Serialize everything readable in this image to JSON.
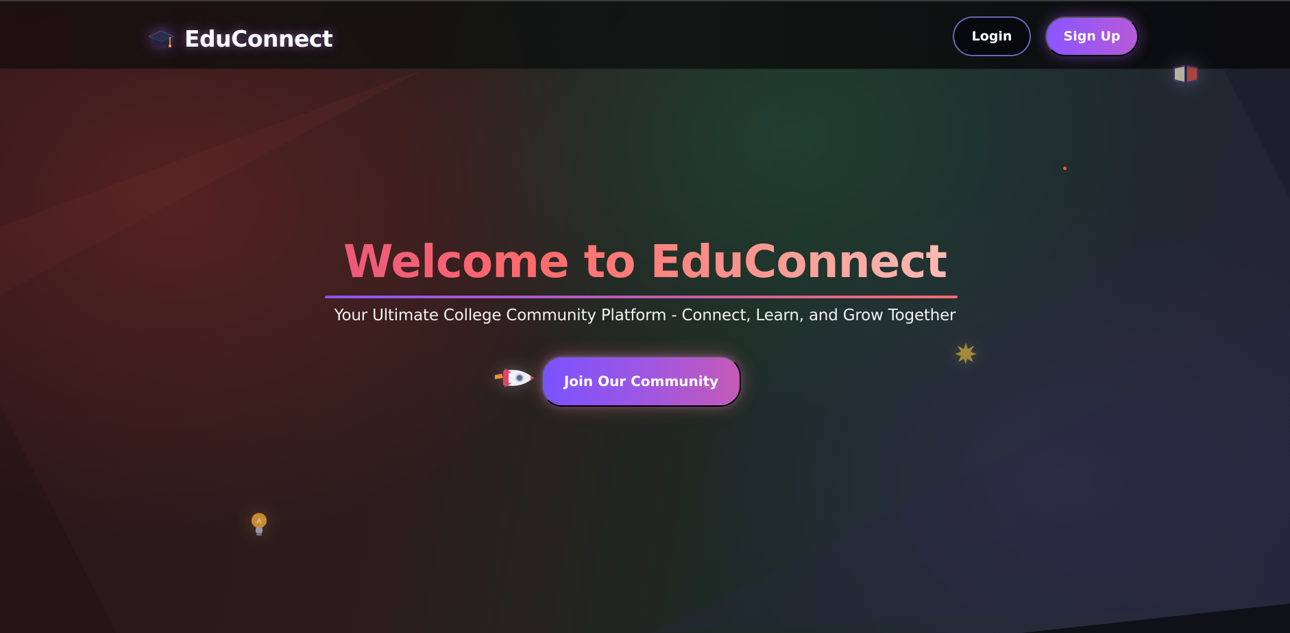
{
  "header": {
    "brand_name": "EduConnect",
    "brand_icon": "graduation-cap-icon",
    "login_label": "Login",
    "signup_label": "Sign Up"
  },
  "hero": {
    "title": "Welcome to EduConnect",
    "subtitle": "Your Ultimate College Community Platform - Connect, Learn, and Grow Together",
    "cta_label": "Join Our Community"
  },
  "decorations": {
    "icons": [
      "rocket-icon",
      "star-burst-icon",
      "light-bulb-icon",
      "book-icon"
    ]
  },
  "colors": {
    "accent_purple": "#8b55ff",
    "accent_pink": "#c65ab6",
    "title_gradient_start": "#e8567c",
    "title_gradient_end": "#ffc2bd",
    "login_border": "#6a66b6"
  }
}
